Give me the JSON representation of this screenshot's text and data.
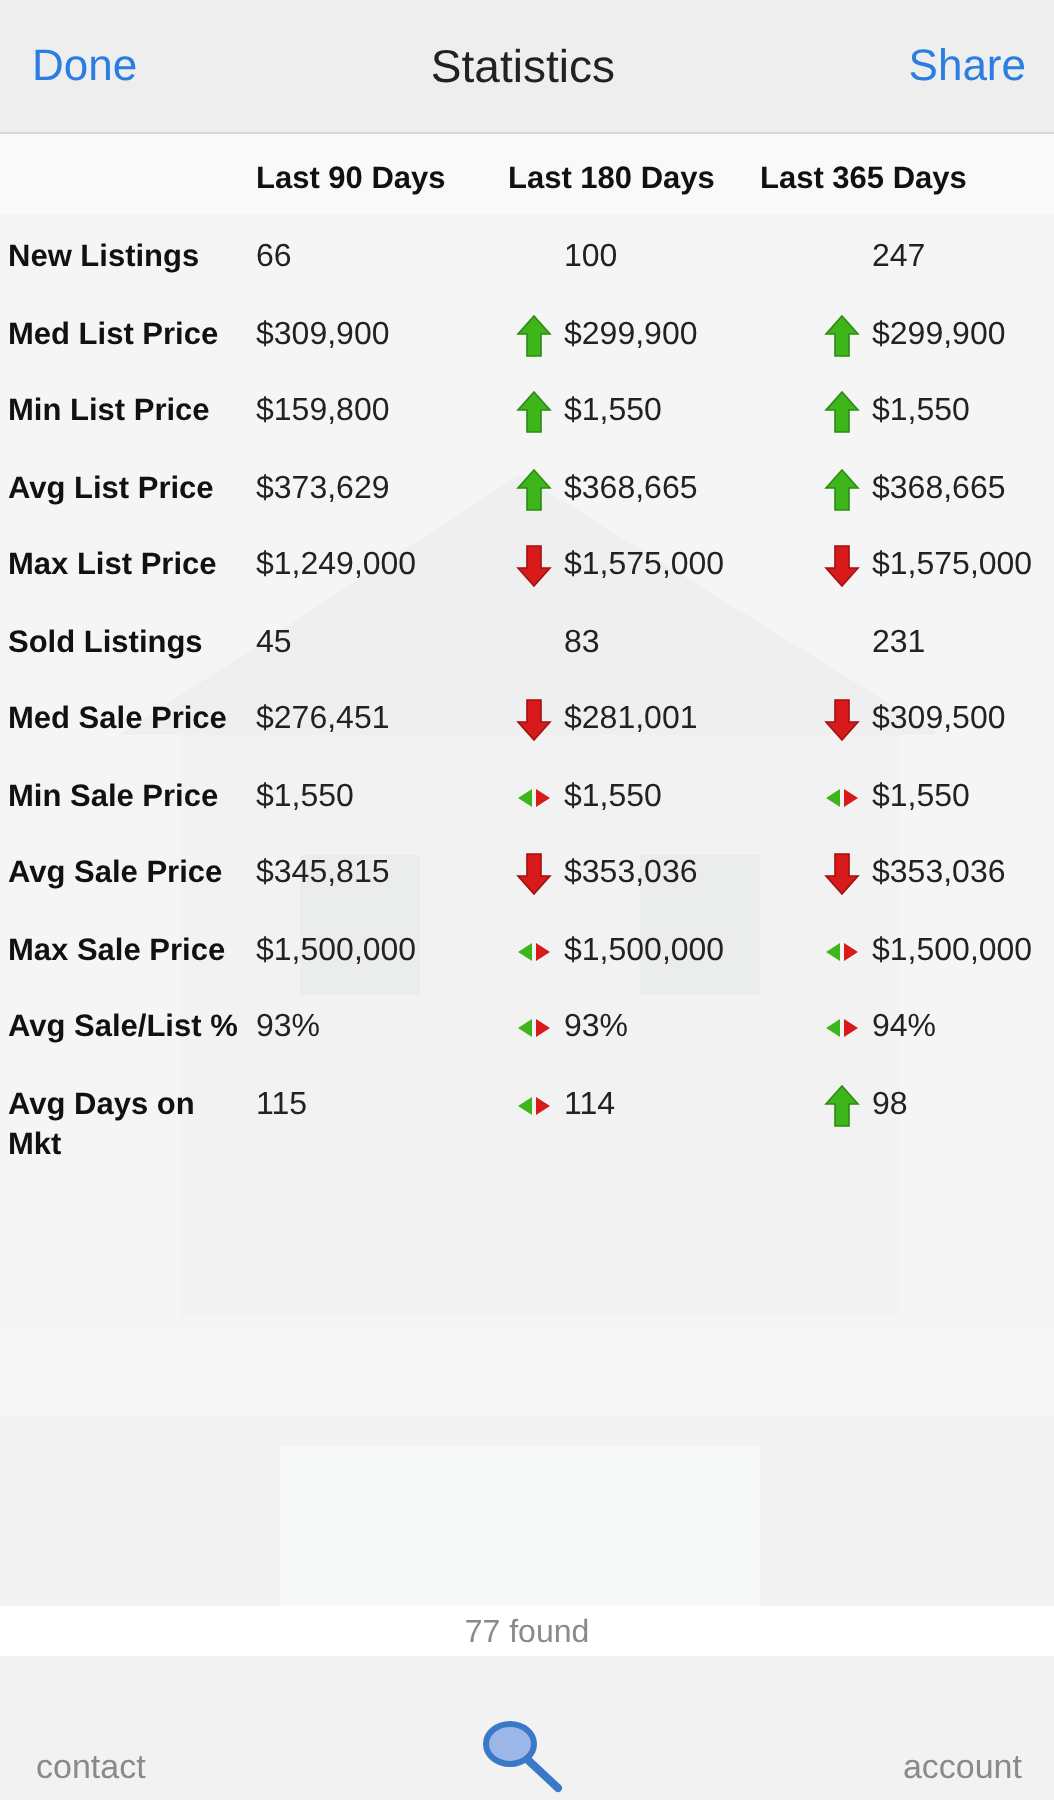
{
  "nav_bar": {
    "left_button": "Done",
    "title": "Statistics",
    "right_button": "Share"
  },
  "table": {
    "columns": [
      "Last 90 Days",
      "Last 180 Days",
      "Last 365 Days"
    ],
    "rows": [
      {
        "label": "New Listings",
        "cells": [
          {
            "kind": "plain",
            "value": "66"
          },
          {
            "kind": "plain",
            "value": "100"
          },
          {
            "kind": "plain",
            "value": "247"
          }
        ]
      },
      {
        "label": "Med List Price",
        "cells": [
          {
            "kind": "plain",
            "value": "$309,900"
          },
          {
            "kind": "up",
            "value": "$299,900"
          },
          {
            "kind": "up",
            "value": "$299,900"
          }
        ]
      },
      {
        "label": "Min List Price",
        "cells": [
          {
            "kind": "plain",
            "value": "$159,800"
          },
          {
            "kind": "up",
            "value": "$1,550"
          },
          {
            "kind": "up",
            "value": "$1,550"
          }
        ]
      },
      {
        "label": "Avg List Price",
        "cells": [
          {
            "kind": "plain",
            "value": "$373,629"
          },
          {
            "kind": "up",
            "value": "$368,665"
          },
          {
            "kind": "up",
            "value": "$368,665"
          }
        ]
      },
      {
        "label": "Max List Price",
        "cells": [
          {
            "kind": "plain",
            "value": "$1,249,000"
          },
          {
            "kind": "down",
            "value": "$1,575,000"
          },
          {
            "kind": "down",
            "value": "$1,575,000"
          }
        ]
      },
      {
        "label": "Sold Listings",
        "cells": [
          {
            "kind": "plain",
            "value": "45"
          },
          {
            "kind": "plain",
            "value": "83"
          },
          {
            "kind": "plain",
            "value": "231"
          }
        ]
      },
      {
        "label": "Med Sale Price",
        "cells": [
          {
            "kind": "plain",
            "value": "$276,451"
          },
          {
            "kind": "down",
            "value": "$281,001"
          },
          {
            "kind": "down",
            "value": "$309,500"
          }
        ]
      },
      {
        "label": "Min Sale Price",
        "cells": [
          {
            "kind": "plain",
            "value": "$1,550"
          },
          {
            "kind": "same",
            "value": "$1,550"
          },
          {
            "kind": "same",
            "value": "$1,550"
          }
        ]
      },
      {
        "label": "Avg Sale Price",
        "cells": [
          {
            "kind": "plain",
            "value": "$345,815"
          },
          {
            "kind": "down",
            "value": "$353,036"
          },
          {
            "kind": "down",
            "value": "$353,036"
          }
        ]
      },
      {
        "label": "Max Sale Price",
        "cells": [
          {
            "kind": "plain",
            "value": "$1,500,000"
          },
          {
            "kind": "same",
            "value": "$1,500,000"
          },
          {
            "kind": "same",
            "value": "$1,500,000"
          }
        ]
      },
      {
        "label": "Avg Sale/List %",
        "cells": [
          {
            "kind": "plain",
            "value": "93%"
          },
          {
            "kind": "same",
            "value": "93%"
          },
          {
            "kind": "same",
            "value": "94%"
          }
        ]
      },
      {
        "label": "Avg Days on Mkt",
        "cells": [
          {
            "kind": "plain",
            "value": "115"
          },
          {
            "kind": "same",
            "value": "114"
          },
          {
            "kind": "up",
            "value": "98"
          }
        ]
      }
    ]
  },
  "results_count": "77 found",
  "tab_bar": [
    {
      "kind": "text",
      "label": "contact"
    },
    {
      "kind": "search"
    },
    {
      "kind": "text",
      "label": "account"
    }
  ]
}
